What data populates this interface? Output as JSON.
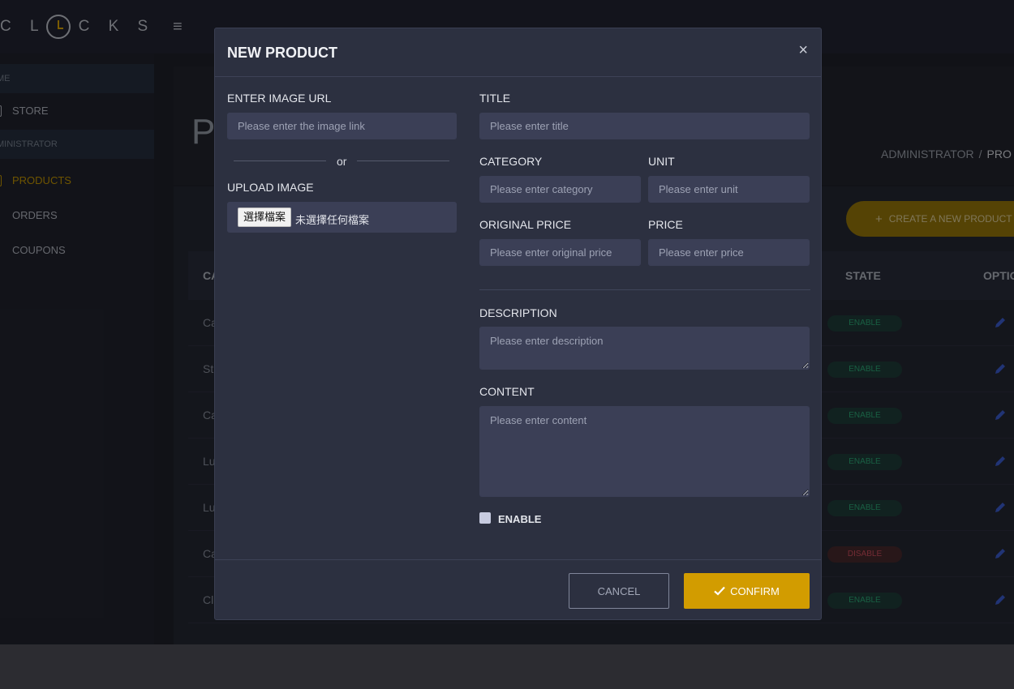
{
  "app": {
    "logo_left": "C L",
    "logo_right": "C K S",
    "sidebar": {
      "section_1": "ME",
      "store": "STORE",
      "section_2": "MINISTRATOR",
      "products": "PRODUCTS",
      "orders": "ORDERS",
      "coupons": "COUPONS"
    },
    "page_title": "P",
    "breadcrumb": {
      "root": "ADMINISTRATOR",
      "sep": "/",
      "current": "PRO"
    },
    "create_button": "CREATE A NEW PRODUCT",
    "table": {
      "headers": {
        "first": "CA",
        "state": "STATE",
        "options": "OPTIO"
      },
      "rows": [
        {
          "first": "Ca",
          "state": "ENABLE"
        },
        {
          "first": "St",
          "state": "ENABLE"
        },
        {
          "first": "Ca",
          "state": "ENABLE"
        },
        {
          "first": "Lu",
          "state": "ENABLE"
        },
        {
          "first": "Lu",
          "state": "ENABLE"
        },
        {
          "first": "Ca",
          "state": "DISABLE"
        },
        {
          "first": "Cl",
          "state": "ENABLE"
        }
      ]
    },
    "colors": {
      "accent": "#d29c00",
      "enable": "#2fae7b",
      "disable": "#d45060"
    }
  },
  "modal": {
    "title": "NEW PRODUCT",
    "close_symbol": "×",
    "image_url": {
      "label": "ENTER IMAGE URL",
      "placeholder": "Please enter the image link"
    },
    "or_text": "or",
    "upload": {
      "label": "UPLOAD IMAGE",
      "button": "選擇檔案",
      "status": "未選擇任何檔案"
    },
    "title_field": {
      "label": "TITLE",
      "placeholder": "Please enter title"
    },
    "category": {
      "label": "CATEGORY",
      "placeholder": "Please enter category"
    },
    "unit": {
      "label": "UNIT",
      "placeholder": "Please enter unit"
    },
    "original_price": {
      "label": "ORIGINAL PRICE",
      "placeholder": "Please enter original price"
    },
    "price": {
      "label": "PRICE",
      "placeholder": "Please enter price"
    },
    "description": {
      "label": "DESCRIPTION",
      "placeholder": "Please enter description"
    },
    "content": {
      "label": "CONTENT",
      "placeholder": "Please enter content"
    },
    "enable_label": "ENABLE",
    "enable_checked": false,
    "cancel": "CANCEL",
    "confirm": "CONFIRM"
  }
}
